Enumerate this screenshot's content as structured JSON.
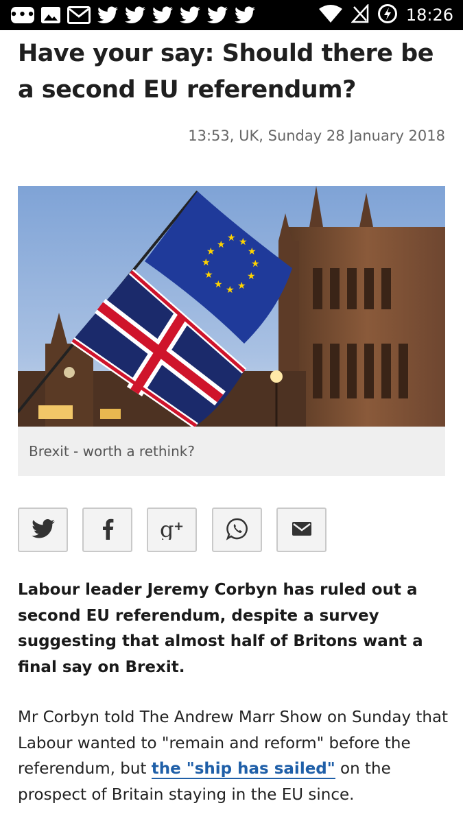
{
  "status_bar": {
    "time": "18:26",
    "notification_icons": [
      "more-icon",
      "image-icon",
      "gmail-icon",
      "twitter-icon",
      "twitter-icon",
      "twitter-icon",
      "twitter-icon",
      "twitter-icon",
      "twitter-icon"
    ],
    "system_icons": [
      "wifi-icon",
      "no-signal-icon",
      "battery-saver-icon"
    ]
  },
  "article": {
    "title": "Have your say: Should there be a second EU referendum?",
    "timestamp": "13:53, UK, Sunday 28 January 2018",
    "image_caption": "Brexit - worth a rethink?",
    "lead": "Labour leader Jeremy Corbyn has ruled out a second EU referendum, despite a survey suggesting that almost half of Britons want a final say on Brexit.",
    "body_before_link": "Mr Corbyn told The Andrew Marr Show on Sunday that Labour wanted to \"remain and reform\" before the referendum, but ",
    "body_link": "the \"ship has sailed\"",
    "body_after_link": " on the prospect of Britain staying in the EU since."
  },
  "share_buttons": [
    "twitter-icon",
    "facebook-icon",
    "google-plus-icon",
    "whatsapp-icon",
    "email-icon"
  ],
  "colors": {
    "link": "#1f5fa8",
    "caption_bg": "#efefef",
    "share_border": "#c9c9c9",
    "status_bar_bg": "#000000"
  }
}
